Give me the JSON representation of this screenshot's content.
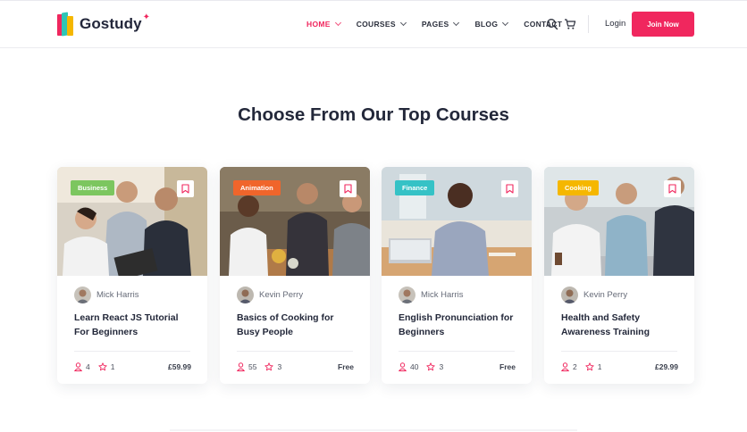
{
  "brand": {
    "name": "Gostudy",
    "star": "✦"
  },
  "nav": {
    "items": [
      {
        "label": "HOME",
        "active": true,
        "has_dropdown": true
      },
      {
        "label": "COURSES",
        "active": false,
        "has_dropdown": true
      },
      {
        "label": "PAGES",
        "active": false,
        "has_dropdown": true
      },
      {
        "label": "BLOG",
        "active": false,
        "has_dropdown": true
      },
      {
        "label": "CONTACT",
        "active": false,
        "has_dropdown": false
      }
    ],
    "icons": [
      "search-icon",
      "cart-icon"
    ],
    "login_label": "Login",
    "join_label": "Join Now"
  },
  "section": {
    "title": "Choose From Our Top Courses"
  },
  "courses": [
    {
      "category": "Business",
      "category_color": "#7cc65f",
      "author": "Mick Harris",
      "title": "Learn React JS Tutorial For Beginners",
      "students": "4",
      "rating": "1",
      "price": "£59.99"
    },
    {
      "category": "Animation",
      "category_color": "#f0652b",
      "author": "Kevin Perry",
      "title": "Basics of Cooking for Busy People",
      "students": "55",
      "rating": "3",
      "price": "Free"
    },
    {
      "category": "Finance",
      "category_color": "#35c2c6",
      "author": "Mick Harris",
      "title": "English Pronunciation for Beginners",
      "students": "40",
      "rating": "3",
      "price": "Free"
    },
    {
      "category": "Cooking",
      "category_color": "#f5b700",
      "author": "Kevin Perry",
      "title": "Health and Safety Awareness Training",
      "students": "2",
      "rating": "1",
      "price": "£29.99"
    }
  ],
  "colors": {
    "accent": "#f0275e",
    "text_dark": "#23283a"
  }
}
